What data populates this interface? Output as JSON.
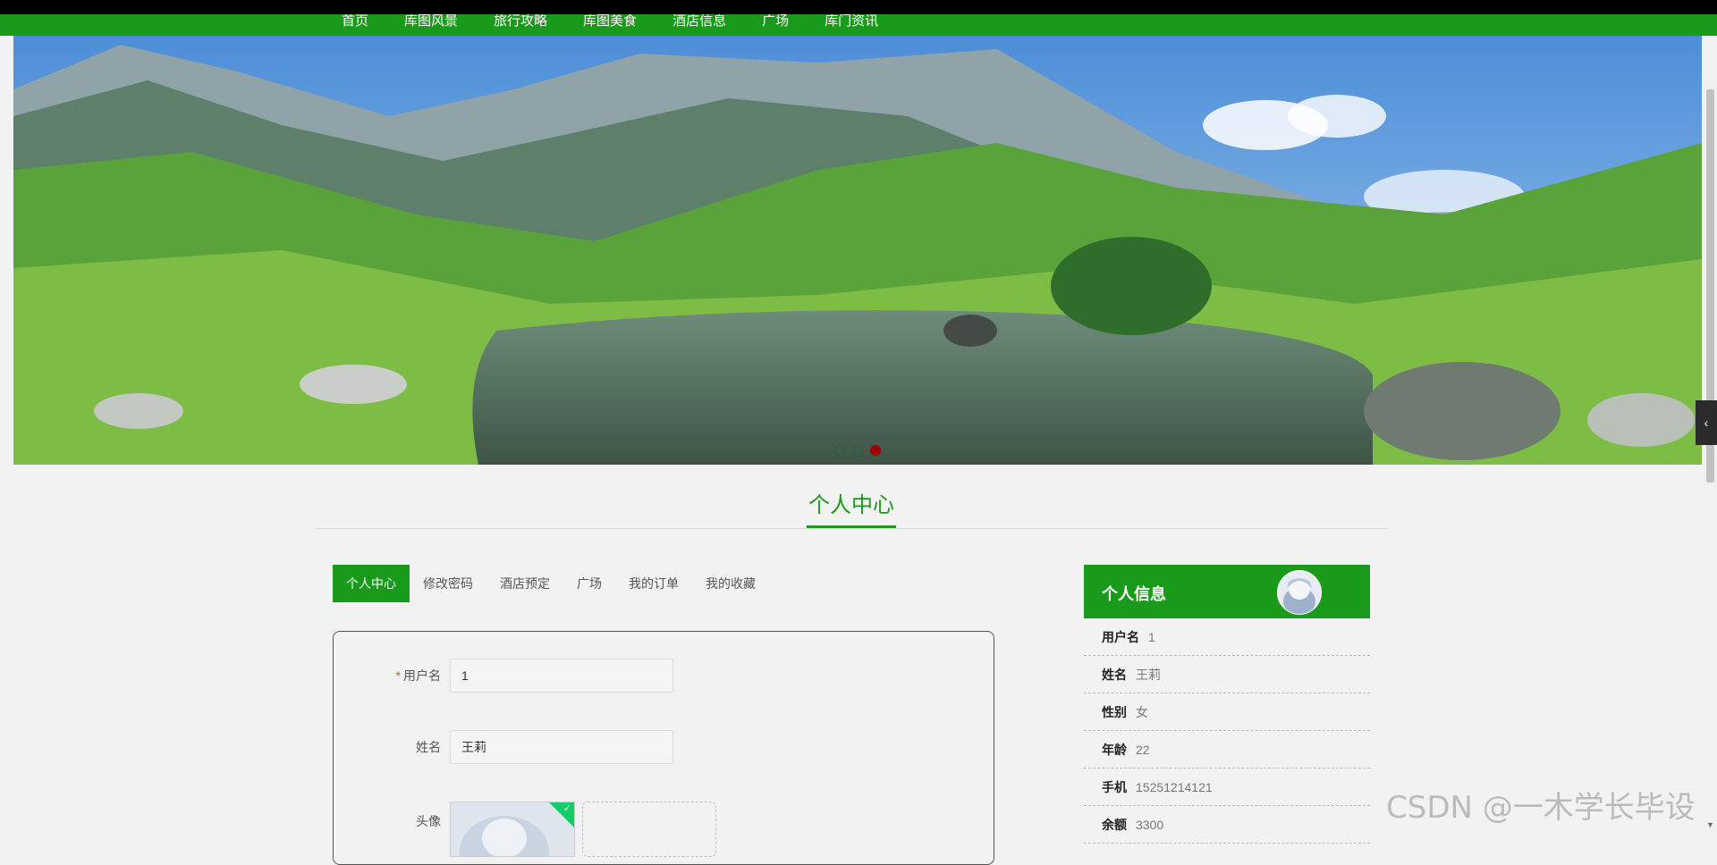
{
  "nav": {
    "items": [
      "首页",
      "库图风景",
      "旅行攻略",
      "库图美食",
      "酒店信息",
      "广场",
      "库门资讯"
    ]
  },
  "banner": {
    "slides": 3,
    "active_slide": 3
  },
  "page": {
    "section_title": "个人中心"
  },
  "tabs": {
    "items": [
      "个人中心",
      "修改密码",
      "酒店预定",
      "广场",
      "我的订单",
      "我的收藏"
    ],
    "active": "个人中心"
  },
  "form": {
    "username_label": "用户名",
    "username_value": "1",
    "name_label": "姓名",
    "name_value": "王莉",
    "avatar_label": "头像"
  },
  "info": {
    "title": "个人信息",
    "rows": [
      {
        "key": "用户名",
        "value": "1"
      },
      {
        "key": "姓名",
        "value": "王莉"
      },
      {
        "key": "性别",
        "value": "女"
      },
      {
        "key": "年龄",
        "value": "22"
      },
      {
        "key": "手机",
        "value": "15251214121"
      },
      {
        "key": "余额",
        "value": "3300"
      }
    ]
  },
  "watermark": "CSDN @一木学长毕设",
  "colors": {
    "primary": "#1a9a1a",
    "active_dot": "#a00000"
  }
}
